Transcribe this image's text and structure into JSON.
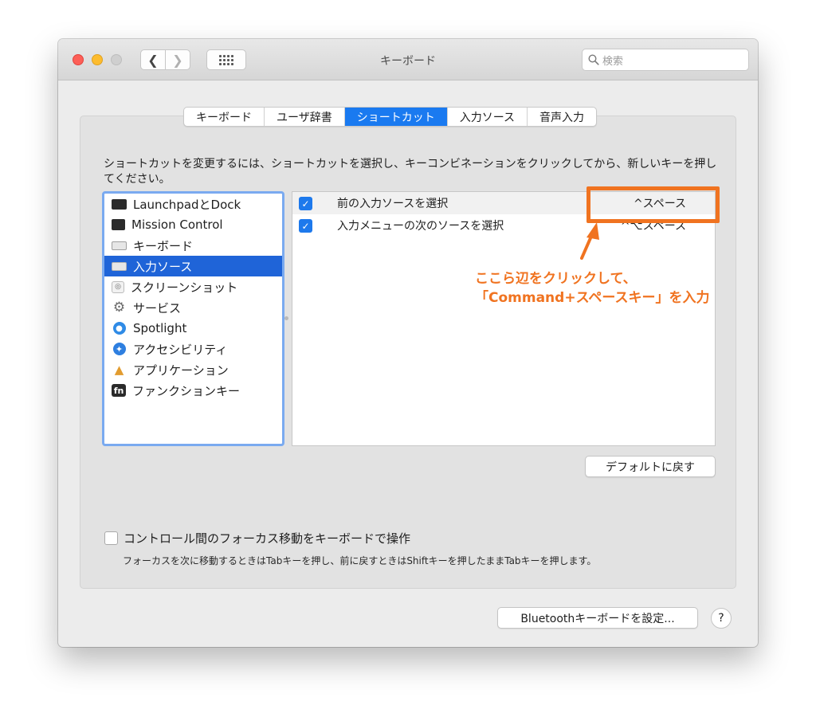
{
  "window": {
    "title": "キーボード"
  },
  "search": {
    "placeholder": "検索"
  },
  "tabs": [
    {
      "label": "キーボード",
      "active": false
    },
    {
      "label": "ユーザ辞書",
      "active": false
    },
    {
      "label": "ショートカット",
      "active": true
    },
    {
      "label": "入力ソース",
      "active": false
    },
    {
      "label": "音声入力",
      "active": false
    }
  ],
  "description": "ショートカットを変更するには、ショートカットを選択し、キーコンビネーションをクリックしてから、新しいキーを押してください。",
  "categories": [
    {
      "label": "LaunchpadとDock",
      "icon": "launchpad-icon"
    },
    {
      "label": "Mission Control",
      "icon": "mission-control-icon"
    },
    {
      "label": "キーボード",
      "icon": "keyboard-icon"
    },
    {
      "label": "入力ソース",
      "icon": "input-source-icon",
      "selected": true
    },
    {
      "label": "スクリーンショット",
      "icon": "screenshot-icon"
    },
    {
      "label": "サービス",
      "icon": "gear-icon"
    },
    {
      "label": "Spotlight",
      "icon": "spotlight-icon"
    },
    {
      "label": "アクセシビリティ",
      "icon": "accessibility-icon"
    },
    {
      "label": "アプリケーション",
      "icon": "app-store-icon"
    },
    {
      "label": "ファンクションキー",
      "icon": "fn-key-icon"
    }
  ],
  "shortcuts": [
    {
      "label": "前の入力ソースを選択",
      "key": "^スペース",
      "checked": true
    },
    {
      "label": "入力メニューの次のソースを選択",
      "key": "^⌥スペース",
      "checked": true
    }
  ],
  "annotation": {
    "line1": "ここら辺をクリックして、",
    "line2": "「Command+スペースキー」を入力",
    "color": "#f07320"
  },
  "buttons": {
    "restore_default": "デフォルトに戻す",
    "bluetooth_setup": "Bluetoothキーボードを設定...",
    "help": "?"
  },
  "full_keyboard_access": {
    "label": "コントロール間のフォーカス移動をキーボードで操作",
    "checked": false,
    "description": "フォーカスを次に移動するときはTabキーを押し、前に戻すときはShiftキーを押したままTabキーを押します。"
  },
  "colors": {
    "accent": "#1a7af0",
    "selection": "#1f64d8",
    "annotation": "#f07320"
  }
}
